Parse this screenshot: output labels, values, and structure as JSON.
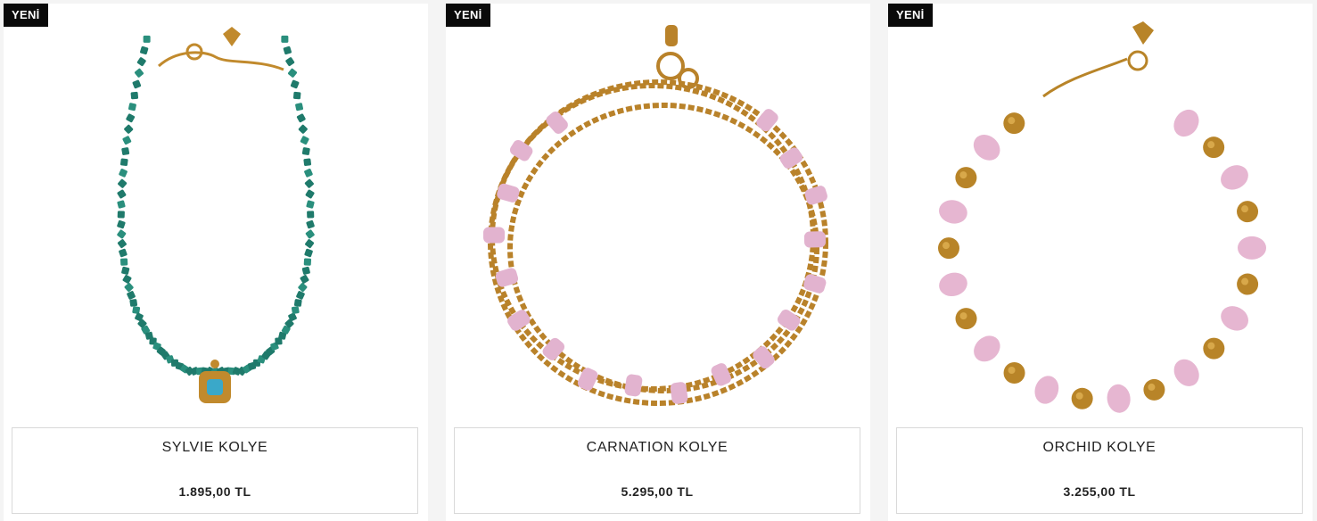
{
  "products": [
    {
      "badge": "YENİ",
      "name": "SYLVIE KOLYE",
      "price": "1.895,00 TL",
      "image": "green-bead-necklace-with-turquoise-pendant",
      "colors": {
        "bead": "#1f7a6b",
        "metal": "#c18a2d"
      }
    },
    {
      "badge": "YENİ",
      "name": "CARNATION KOLYE",
      "price": "5.295,00 TL",
      "image": "multi-strand-gold-chain-with-pink-stones",
      "colors": {
        "bead": "#e2b3cf",
        "metal": "#b9822a"
      }
    },
    {
      "badge": "YENİ",
      "name": "ORCHID KOLYE",
      "price": "3.255,00 TL",
      "image": "pink-stone-and-gold-bead-necklace",
      "colors": {
        "bead": "#e6b6d1",
        "metal": "#b88428"
      }
    }
  ]
}
